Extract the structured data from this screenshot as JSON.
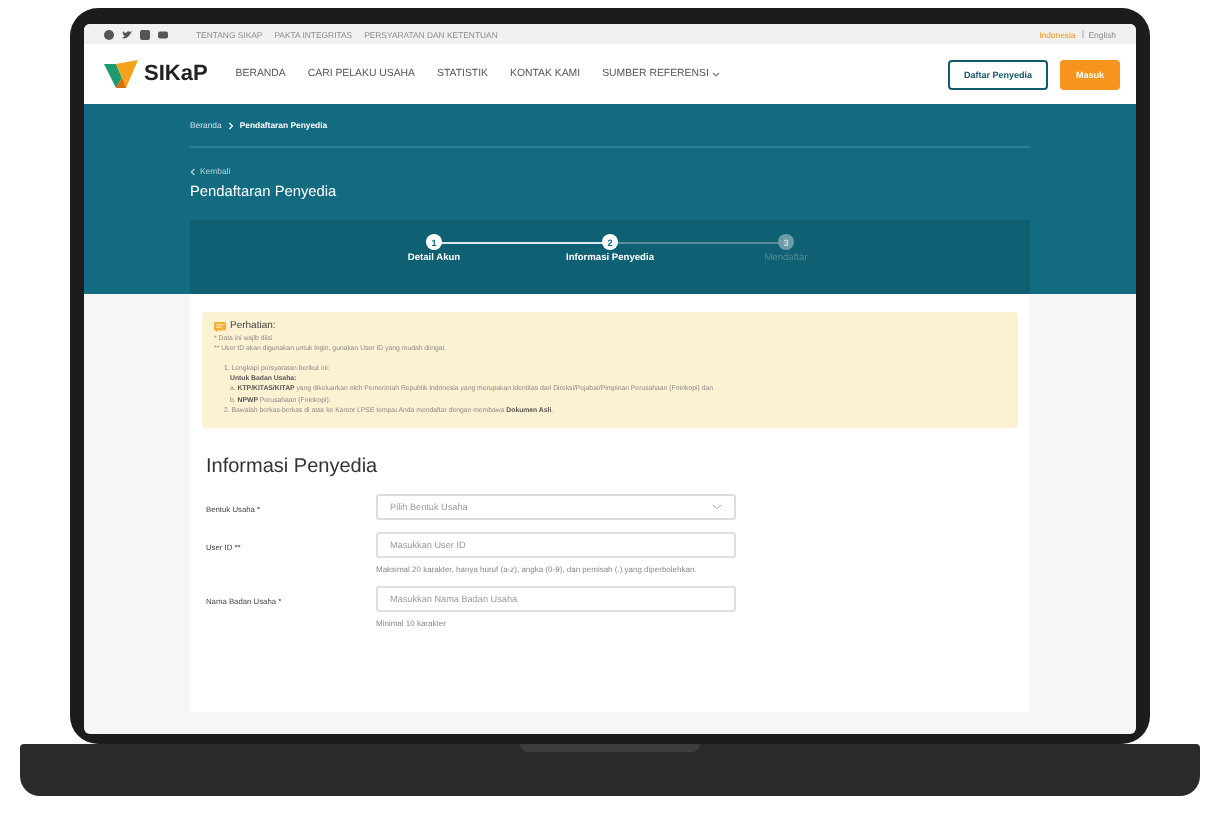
{
  "top_bar": {
    "links": [
      "TENTANG SIKAP",
      "PAKTA INTEGRITAS",
      "PERSYARATAN DAN KETENTUAN"
    ],
    "languages": [
      {
        "label": "Indonesia",
        "selected": true
      },
      {
        "label": "English",
        "selected": false
      }
    ]
  },
  "nav": {
    "logo_text": "SIKaP",
    "links": [
      {
        "label": "BERANDA",
        "dropdown": false
      },
      {
        "label": "CARI PELAKU USAHA",
        "dropdown": false
      },
      {
        "label": "STATISTIK",
        "dropdown": false
      },
      {
        "label": "KONTAK KAMI",
        "dropdown": false
      },
      {
        "label": "SUMBER REFERENSI",
        "dropdown": true
      }
    ],
    "buttons": [
      {
        "label": "Daftar Penyedia",
        "kind": "outline"
      },
      {
        "label": "Masuk",
        "kind": "primary"
      }
    ]
  },
  "breadcrumb": [
    "Beranda",
    "Pendaftaran Penyedia"
  ],
  "back_link": "Kembali",
  "page_title": "Pendaftaran Penyedia",
  "steps": [
    {
      "number": "1",
      "label": "Detail Akun",
      "active": true
    },
    {
      "number": "2",
      "label": "Informasi Penyedia",
      "active": true
    },
    {
      "number": "3",
      "label": "Mendaftar",
      "active": false
    }
  ],
  "notice": {
    "title": "Perhatian:",
    "notes": [
      "* Data ini wajib diisi",
      "** User ID akan digunakan untuk login, gunakan User ID yang mudah diingat."
    ],
    "items": [
      {
        "text": "1. Lengkapi persyaratan berikut ini:",
        "subtitle": "Untuk Badan Usaha:",
        "subitems": [
          "a. **KTP/KITAS/KITAP** yang dikeluarkan oleh Pemerintah Republik Indonesia yang merupakan identitas dari Direksi/Pejabat/Pimpinan Perusahaan (Fotokopi) dan",
          "b. **NPWP** Perusahaan (Fotokopi)."
        ]
      },
      {
        "text": "2. Bawalah berkas-berkas di atas ke Kantor LPSE tempat Anda mendaftar dengan membawa **Dokumen Asli**."
      }
    ]
  },
  "form": {
    "title": "Informasi Penyedia",
    "fields": [
      {
        "kind": "select",
        "label": "Bentuk Usaha *",
        "placeholder": "Pilih Bentuk Usaha"
      },
      {
        "kind": "input",
        "label": "User ID **",
        "placeholder": "Masukkan User ID",
        "hint": "Maksimal 20 karakter, hanya huruf (a-z), angka (0-9), dan pemisah (.) yang diperbolehkan."
      },
      {
        "kind": "input",
        "label": "Nama Badan Usaha *",
        "placeholder": "Masukkan Nama Badan Usaha",
        "hint": "Minimal 10 karakter"
      }
    ]
  }
}
